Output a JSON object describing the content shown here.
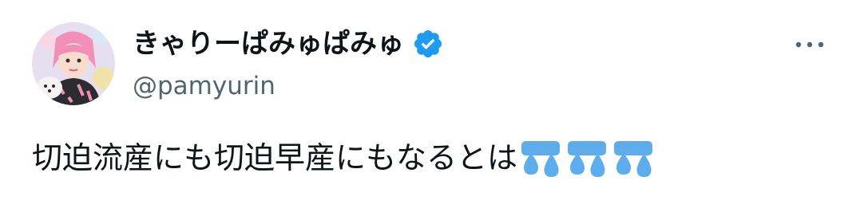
{
  "author": {
    "display_name": "きゃりーぱみゅぱみゅ",
    "handle": "@pamyurin",
    "verified": true
  },
  "tweet": {
    "text": "切迫流産にも切迫早産にもなるとは",
    "emojis": [
      "sweat-droplets-emoji",
      "sweat-droplets-emoji",
      "sweat-droplets-emoji"
    ]
  },
  "icons": {
    "verified": "verified-badge-icon",
    "more": "more-options-icon"
  },
  "colors": {
    "text_primary": "#0f1419",
    "text_secondary": "#536471",
    "verified_blue": "#1d9bf0",
    "emoji_blue": "#5dadec"
  }
}
